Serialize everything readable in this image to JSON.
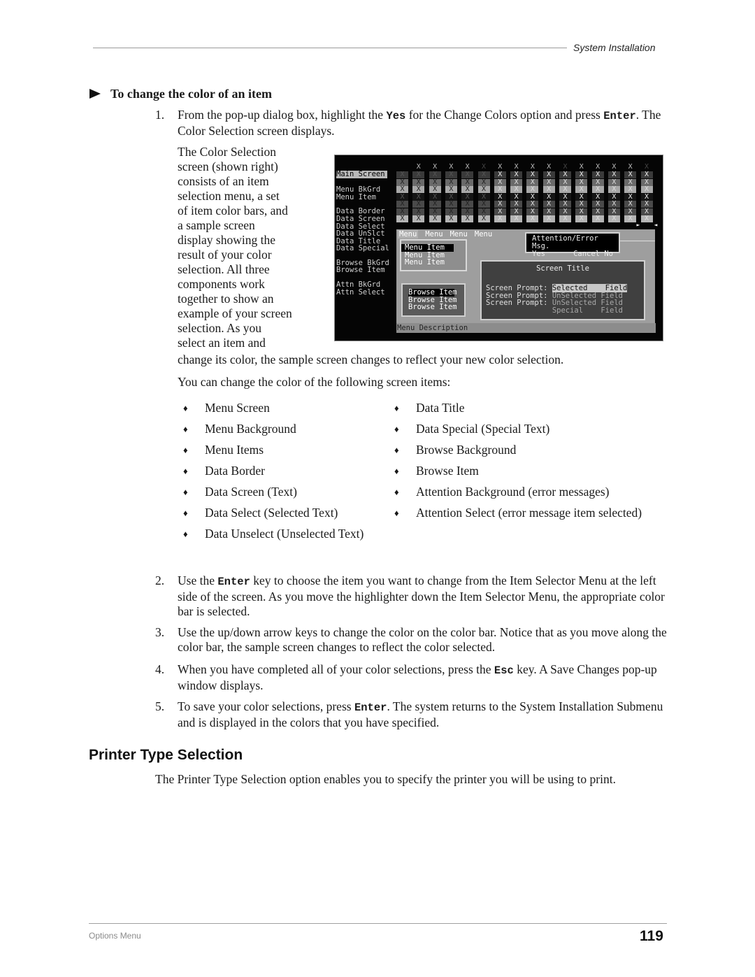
{
  "header": {
    "section": "System Installation"
  },
  "procedure": {
    "title": "To change the color of an item",
    "steps": [
      {
        "num": "1.",
        "pre": "From the pop-up dialog box, highlight the ",
        "key1": "Yes",
        "mid": " for the Change Colors option and press ",
        "key2": "Enter",
        "post": ". The Color Selection screen displays."
      },
      {
        "num": "2.",
        "pre": "Use the ",
        "key1": "Enter",
        "post": " key to choose the item you want to change from the Item Selector Menu at the left side of the screen. As you move the highlighter down the Item Selector Menu, the appropriate color bar is selected."
      },
      {
        "num": "3.",
        "text": "Use the up/down arrow keys to change the color on the color bar. Notice that as you move along the color bar, the sample screen changes to reflect the color selected."
      },
      {
        "num": "4.",
        "pre": "When you have completed all of your color selections, press the ",
        "key1": "Esc",
        "post": " key. A Save Changes pop-up window displays."
      },
      {
        "num": "5.",
        "pre": "To save your color selections, press ",
        "key1": "Enter",
        "post": ". The system returns to the System Installation Submenu and is displayed in the colors that you have specified."
      }
    ],
    "wrap_paragraph_lines": [
      "The Color Selection",
      "screen (shown right)",
      "consists of an item",
      "selection menu, a set",
      "of item color bars, and",
      "a sample screen",
      "display showing the",
      "result of your color",
      "selection. All three",
      "components work",
      "together to show an",
      "example of your screen",
      "selection. As you",
      "select an item and"
    ],
    "wrap_paragraph_continuation": "change its color, the sample screen changes to reflect your new color selection.",
    "items_intro": "You can change the color of the following screen items:",
    "items_left": [
      "Menu Screen",
      "Menu Background",
      "Menu Items",
      "Data Border",
      "Data Screen (Text)",
      "Data Select (Selected Text)",
      "Data Unselect (Unselected Text)"
    ],
    "items_right": [
      "Data Title",
      "Data Special (Special Text)",
      "Browse Background",
      "Browse Item",
      "Attention Background (error messages)",
      "Attention Select (error message item selected)"
    ],
    "bullet_glyph": "♦"
  },
  "color_screen": {
    "item_menu": [
      {
        "label": "Main Screen",
        "selected": true
      },
      {
        "label": "Menu BkGrd"
      },
      {
        "label": "Menu Item"
      },
      {
        "label": "Data Border"
      },
      {
        "label": "Data Screen"
      },
      {
        "label": "Data Select"
      },
      {
        "label": "Data UnSlct"
      },
      {
        "label": "Data Title"
      },
      {
        "label": "Data Special"
      },
      {
        "label": "Browse BkGrd"
      },
      {
        "label": "Browse Item"
      },
      {
        "label": "Attn BkGrd"
      },
      {
        "label": "Attn Select"
      }
    ],
    "bar_glyph": "X",
    "bar_count": 16,
    "bar_rows": 7,
    "selected_bar_index": 15,
    "pointer_glyph_left": "►",
    "pointer_glyph_right": "◄",
    "sample": {
      "menu_bar": [
        "Menu",
        "Menu",
        "Menu",
        "Menu"
      ],
      "menu_items": [
        "Menu Item",
        "Menu Item",
        "Menu Item"
      ],
      "attention": {
        "title": "Attention/Error Msg.",
        "yes": "Yes",
        "cancel": "Cancel",
        "no": "No"
      },
      "data_title": "Screen Title",
      "prompts": [
        {
          "prompt": "Screen Prompt:",
          "value": "Selected   ",
          "field": "Field",
          "state": "selected"
        },
        {
          "prompt": "Screen Prompt:",
          "value": "UnSelected",
          "field": "Field",
          "state": "unselected"
        },
        {
          "prompt": "Screen Prompt:",
          "value": "UnSelected",
          "field": "Field",
          "state": "unselected"
        },
        {
          "prompt": "",
          "value": "Special   ",
          "field": "Field",
          "state": "special"
        }
      ],
      "browse_items": [
        "Browse Item",
        "Browse Item",
        "Browse Item"
      ],
      "description": "Menu Description"
    }
  },
  "section2": {
    "title": "Printer Type Selection",
    "text": "The Printer Type Selection option enables you to specify the printer you will be using to print."
  },
  "footer": {
    "chapter": "Options Menu",
    "page": "119"
  }
}
